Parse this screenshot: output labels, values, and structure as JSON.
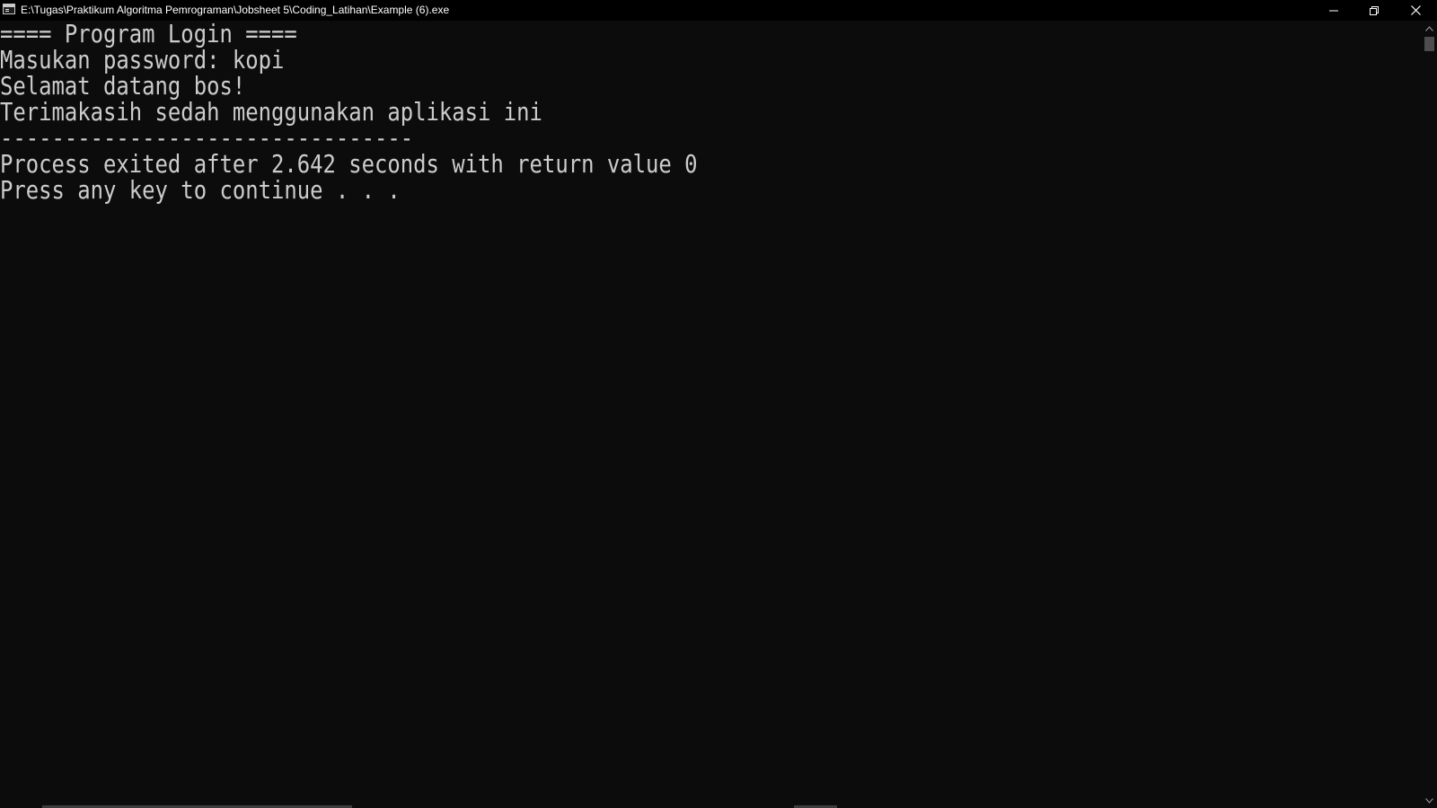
{
  "window": {
    "title": "E:\\Tugas\\Praktikum Algoritma Pemrograman\\Jobsheet 5\\Coding_Latihan\\Example (6).exe",
    "icon": "console-app-icon",
    "controls": {
      "minimize_icon": "minimize-icon",
      "maximize_icon": "restore-icon",
      "close_icon": "close-icon"
    }
  },
  "console": {
    "lines": [
      "==== Program Login ====",
      "Masukan password: kopi",
      "Selamat datang bos!",
      "Terimakasih sedah menggunakan aplikasi ini",
      "--------------------------------",
      "Process exited after 2.642 seconds with return value 0",
      "Press any key to continue . . ."
    ],
    "colors": {
      "background": "#0c0c0c",
      "foreground": "#cccccc",
      "titlebar": "#000000"
    }
  }
}
